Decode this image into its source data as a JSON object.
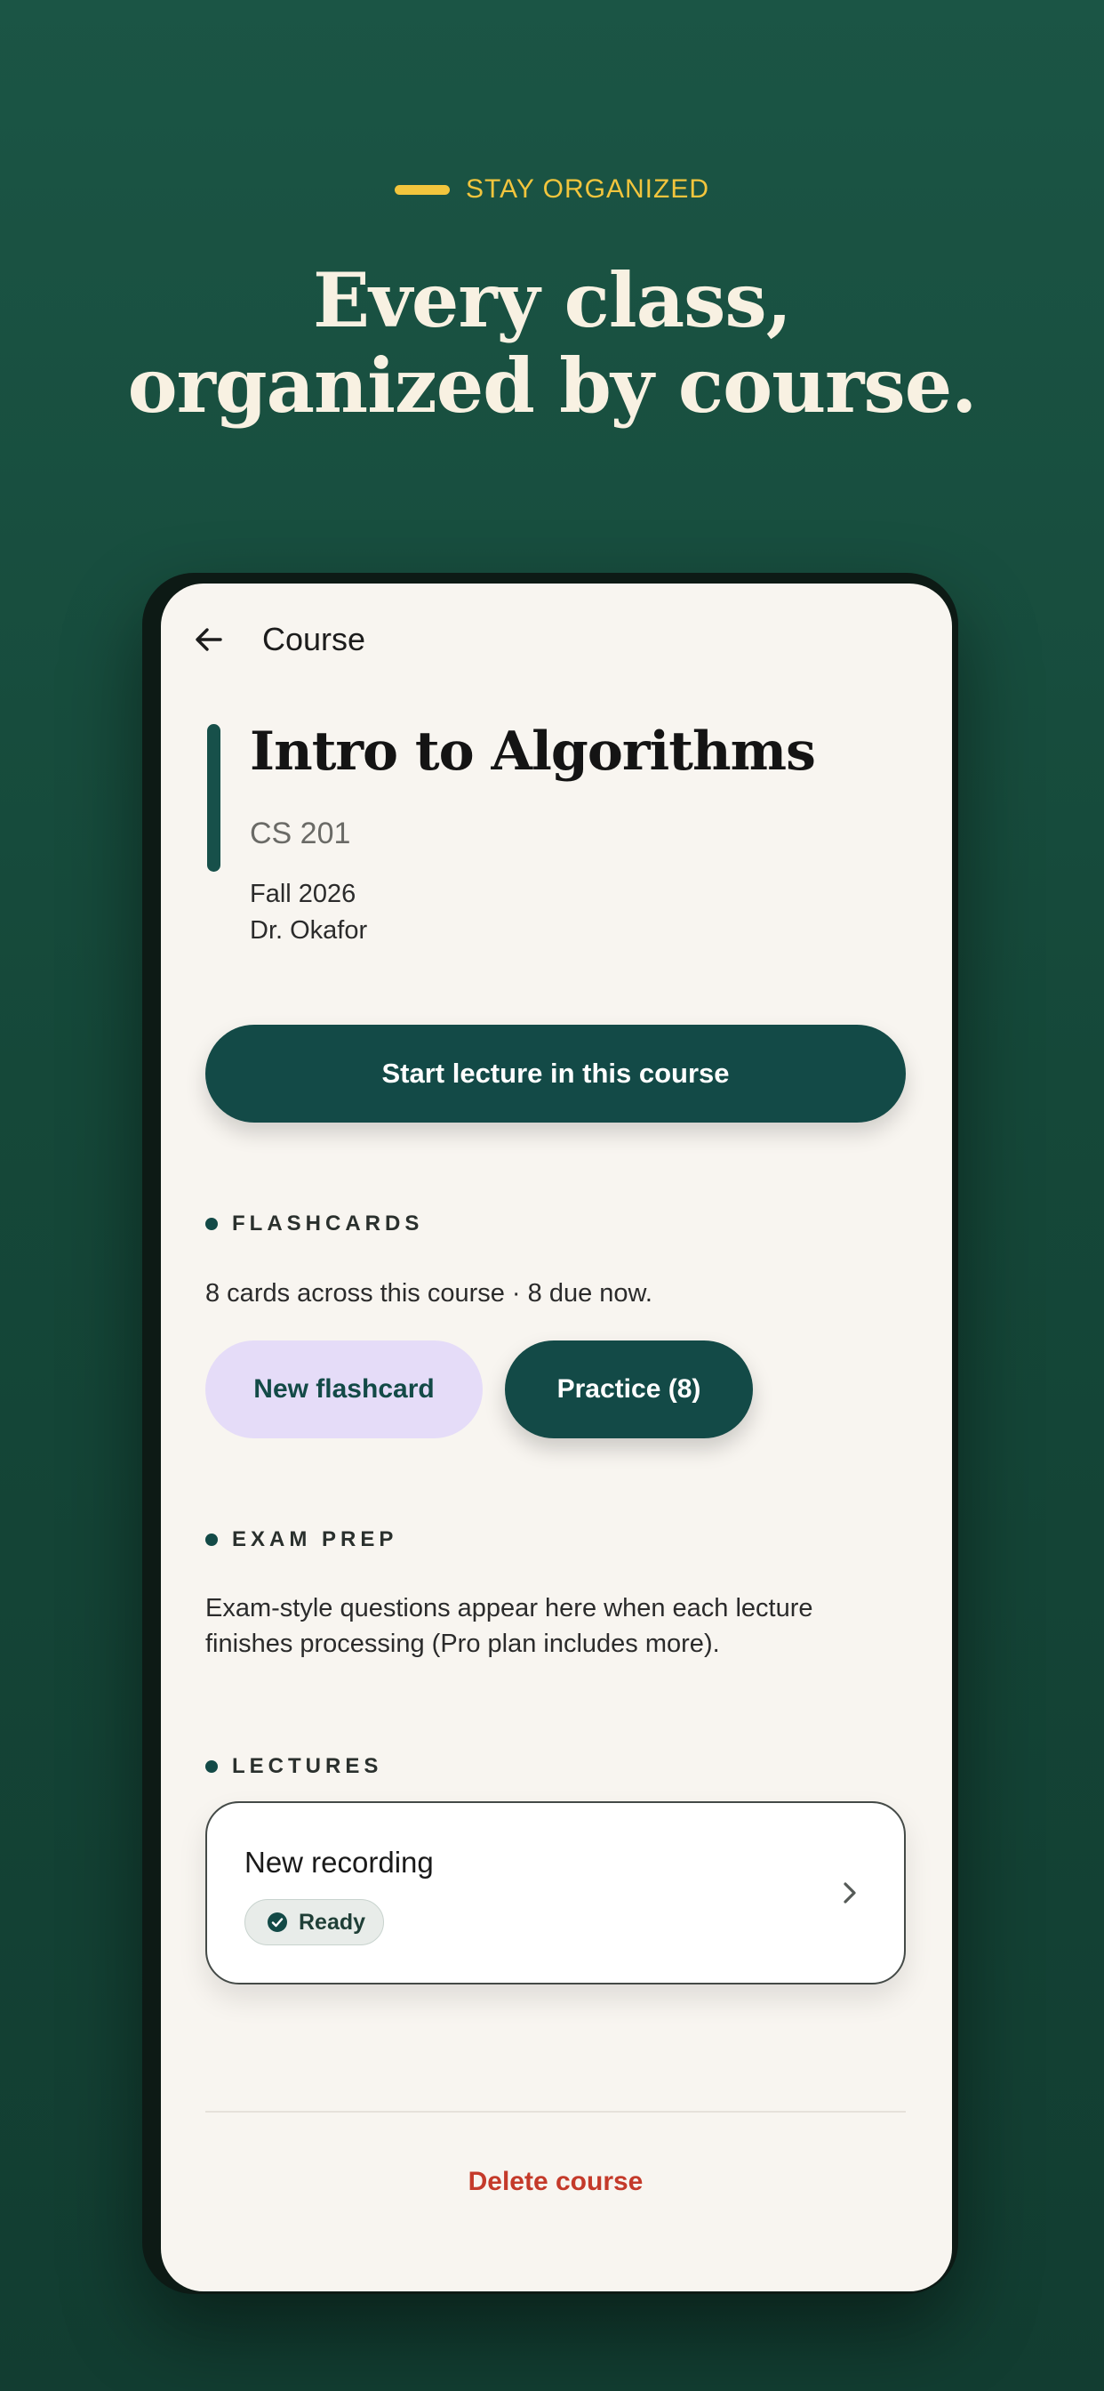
{
  "kicker": {
    "text": "STAY ORGANIZED"
  },
  "headline": {
    "line1": "Every class,",
    "line2": "organized by course."
  },
  "topbar": {
    "title": "Course"
  },
  "course": {
    "title": "Intro to Algorithms",
    "code": "CS 201",
    "term": "Fall 2026",
    "instructor": "Dr. Okafor"
  },
  "primary_action": {
    "label": "Start lecture in this course"
  },
  "flashcards": {
    "label": "FLASHCARDS",
    "summary": "8 cards across this course · 8 due now.",
    "new_label": "New flashcard",
    "practice_label": "Practice (8)"
  },
  "exam_prep": {
    "label": "EXAM PREP",
    "text": "Exam-style questions appear here when each lecture finishes processing (Pro plan includes more)."
  },
  "lectures": {
    "label": "LECTURES",
    "items": [
      {
        "title": "New recording",
        "status": "Ready"
      }
    ]
  },
  "footer": {
    "delete_label": "Delete course"
  },
  "colors": {
    "background": "#154839",
    "accent_yellow": "#f2c53d",
    "primary": "#134a47",
    "secondary_pill": "#e5dcf8",
    "danger": "#c43a2a",
    "screen": "#f8f5f0"
  },
  "icons": {
    "back": "arrow-left-icon",
    "status": "check-circle-icon",
    "lecture_open": "chevron-right-icon"
  }
}
